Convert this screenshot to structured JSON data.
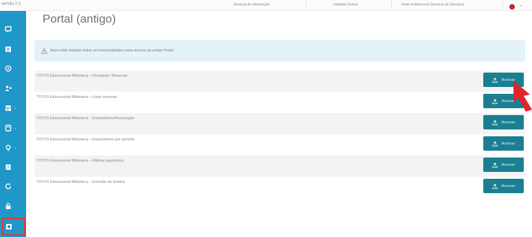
{
  "topbar": {
    "version": "versão 2.3",
    "segments": [
      "Serviços de Informação",
      "Unidade Central",
      "Rede Institucional (Serviços de Serviços)"
    ],
    "avatar_color": "#c1272d"
  },
  "sidebar": {
    "color": "#1f97c9",
    "items": [
      {
        "icon": "chat-icon",
        "caret": ""
      },
      {
        "icon": "list-icon",
        "caret": ""
      },
      {
        "icon": "target-icon",
        "caret": ""
      },
      {
        "icon": "user-switch-icon",
        "caret": ""
      },
      {
        "icon": "grid-icon",
        "caret": "⌄"
      },
      {
        "icon": "package-icon",
        "caret": "⌄"
      },
      {
        "icon": "pin-icon",
        "caret": "⌄"
      },
      {
        "icon": "book-icon",
        "caret": ""
      },
      {
        "icon": "refresh-icon",
        "caret": ""
      },
      {
        "icon": "lock-icon",
        "caret": ""
      },
      {
        "icon": "portal-icon",
        "caret": "",
        "highlighted": true
      }
    ]
  },
  "main": {
    "title": "Portal (antigo)",
    "alert": "Aqui estão listadas todas as funcionalidades para acesso ao antigo Portal",
    "accent_color": "#1b7f93",
    "rows": [
      {
        "label": "TOTVS Educacional Biblioteca – Pesquisar / Reservar",
        "button": "Acessar"
      },
      {
        "label": "TOTVS Educacional Biblioteca – Listar reservas",
        "button": "Acessar"
      },
      {
        "label": "TOTVS Educacional Biblioteca – Empréstimos/Renovação",
        "button": "Acessar"
      },
      {
        "label": "TOTVS Educacional Biblioteca – Empréstimos por período",
        "button": "Acessar"
      },
      {
        "label": "TOTVS Educacional Biblioteca – Últimas aquisições",
        "button": "Acessar"
      },
      {
        "label": "TOTVS Educacional Biblioteca – Emissão de boletos",
        "button": "Acessar"
      }
    ]
  }
}
